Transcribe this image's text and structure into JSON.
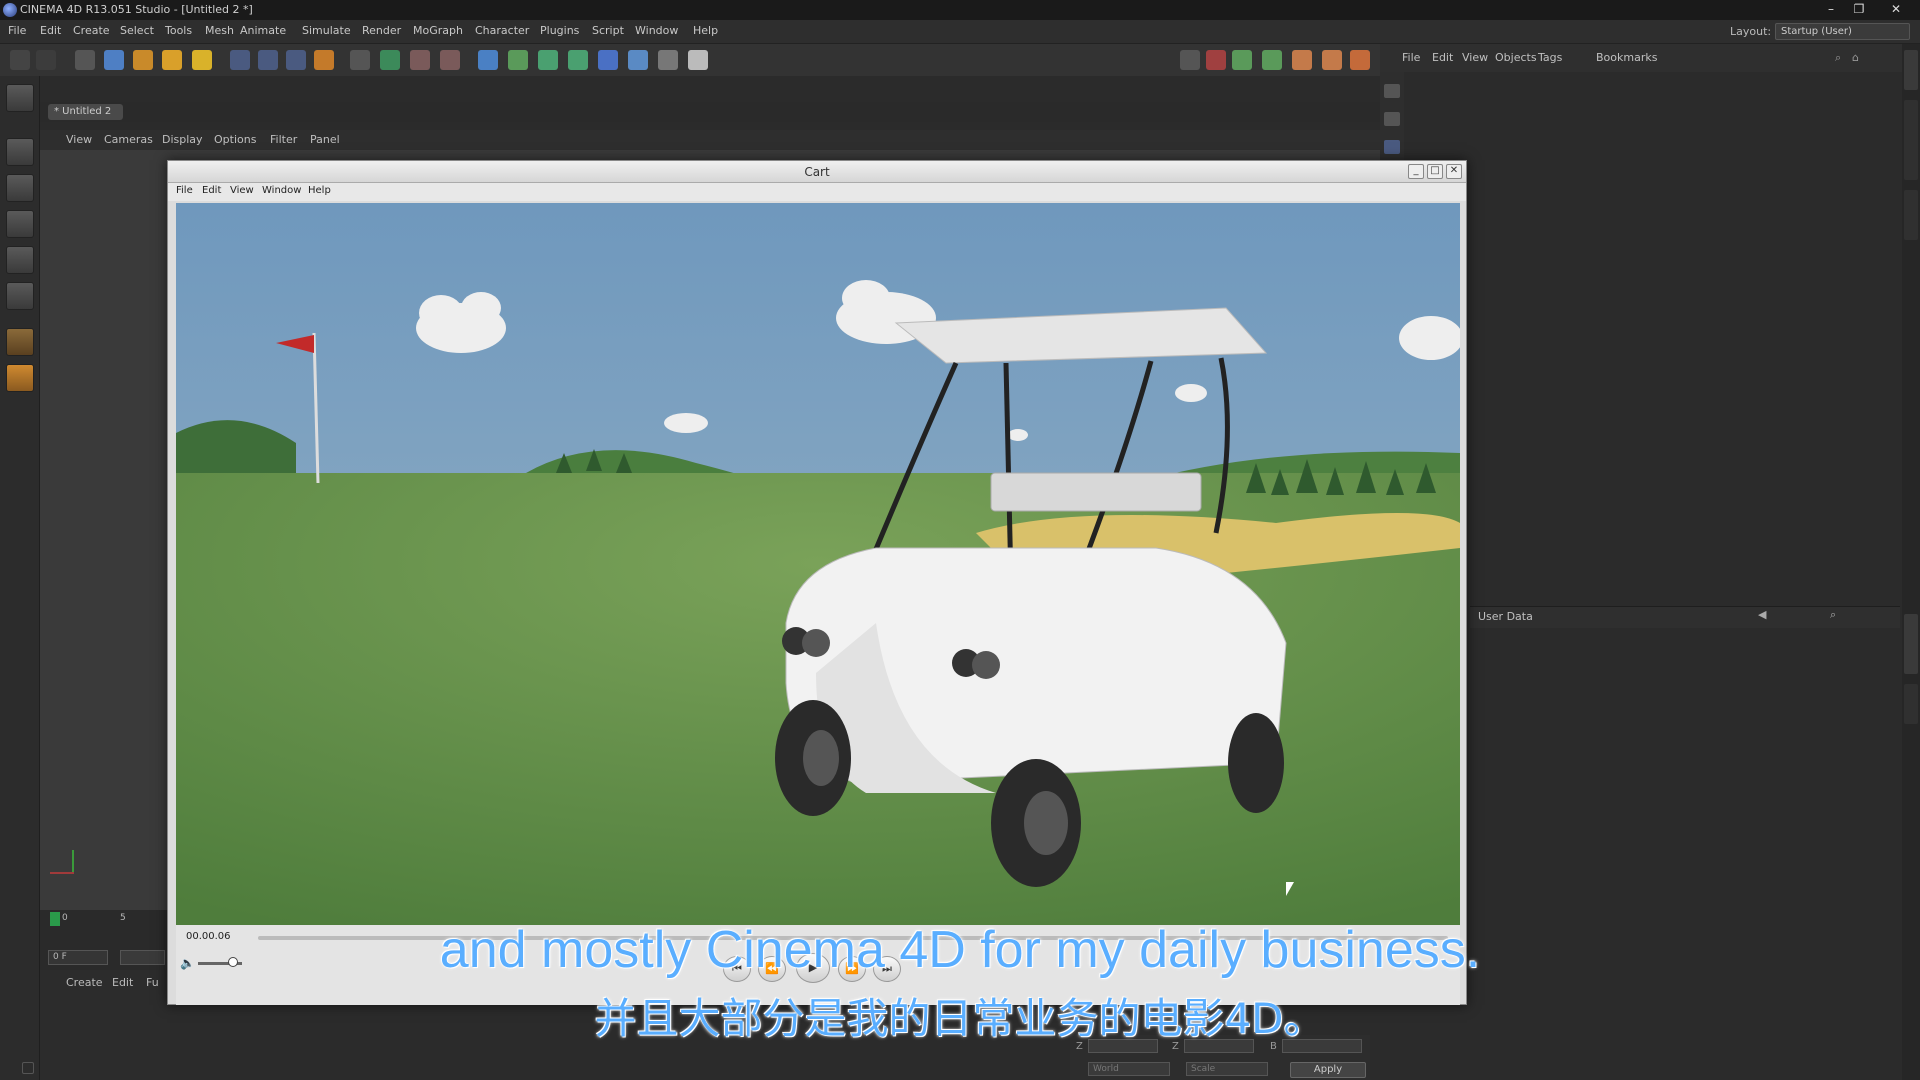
{
  "window": {
    "title": "CINEMA 4D R13.051 Studio - [Untitled 2 *]"
  },
  "menu": {
    "items": [
      "File",
      "Edit",
      "Create",
      "Select",
      "Tools",
      "Mesh",
      "Animate",
      "Simulate",
      "Render",
      "MoGraph",
      "Character",
      "Plugins",
      "Script",
      "Window",
      "Help"
    ]
  },
  "layout": {
    "label": "Layout:",
    "value": "Startup (User)"
  },
  "object_manager": {
    "menu": [
      "File",
      "Edit",
      "View",
      "Objects",
      "Tags",
      "Bookmarks"
    ]
  },
  "tabs": {
    "active": "* Untitled 2"
  },
  "viewport_menu": [
    "View",
    "Cameras",
    "Display",
    "Options",
    "Filter",
    "Panel"
  ],
  "timeline": {
    "frame_start": "0",
    "frame_mark": "5",
    "frame_field": "0 F"
  },
  "bottom_panel": {
    "menu": [
      "Create",
      "Edit",
      "Fu"
    ]
  },
  "attributes": {
    "title": "User Data"
  },
  "coords": {
    "z1": "Z",
    "z2": "Z",
    "b": "B",
    "world": "World",
    "scale": "Scale",
    "apply": "Apply"
  },
  "cart_window": {
    "title": "Cart",
    "menu": [
      "File",
      "Edit",
      "View",
      "Window",
      "Help"
    ],
    "timecode": "00.00.06"
  },
  "subtitles": {
    "en": "and mostly Cinema 4D for my daily business.",
    "zh": "并且大部分是我的日常业务的电影4D。"
  },
  "colors": {
    "subtitle": "#5aaeff",
    "sky": "#7aa0c0",
    "grass": "#5e8f4a"
  }
}
